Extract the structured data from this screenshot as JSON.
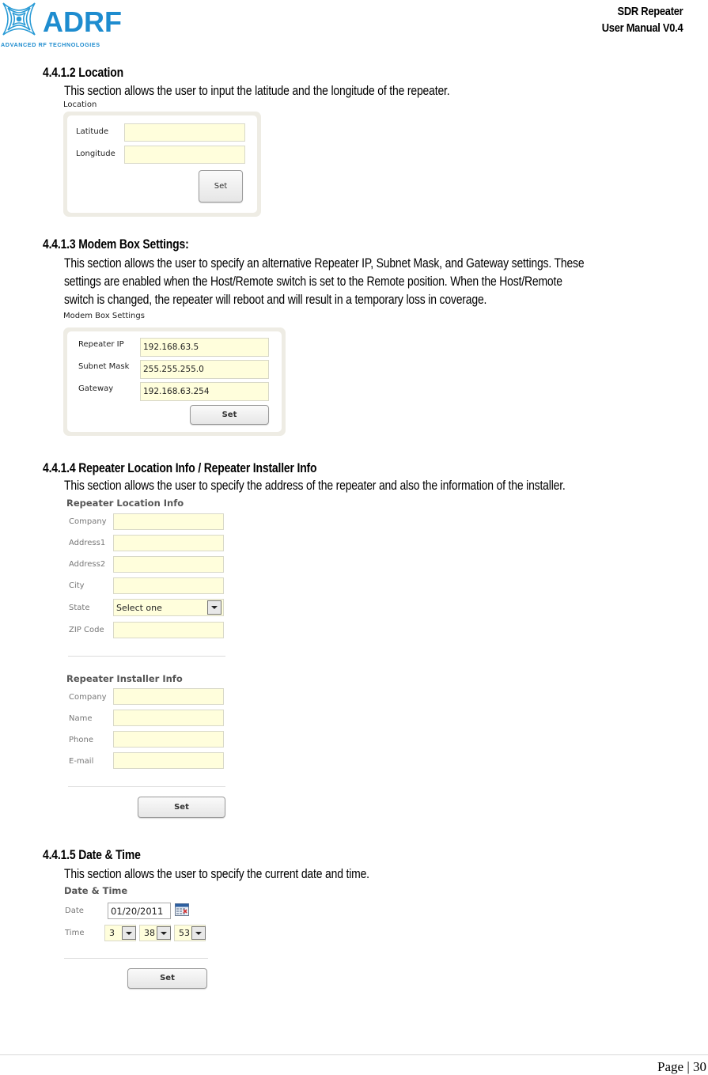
{
  "header": {
    "logo_text": "ADRF",
    "logo_tagline": "ADVANCED RF TECHNOLOGIES",
    "doc_title": "SDR Repeater",
    "doc_subtitle": "User Manual V0.4",
    "brand_color": "#1e8ccf"
  },
  "sections": {
    "location": {
      "heading": "4.4.1.2 Location",
      "body": "This section allows the user to input the latitude and the longitude of the repeater.",
      "caption": "Location",
      "fields": [
        {
          "label": "Latitude",
          "value": ""
        },
        {
          "label": "Longitude",
          "value": ""
        }
      ],
      "button": "Set"
    },
    "modem": {
      "heading": "4.4.1.3 Modem Box Settings:",
      "body_lines": [
        "This section allows the user to specify an alternative Repeater IP, Subnet Mask, and Gateway settings.   These",
        "settings are enabled when the Host/Remote switch is set to the Remote position.   When the Host/Remote",
        "switch is changed, the repeater will reboot and will result in a temporary loss in coverage."
      ],
      "caption": "Modem Box Settings",
      "fields": [
        {
          "label": "Repeater IP",
          "value": "192.168.63.5"
        },
        {
          "label": "Subnet Mask",
          "value": "255.255.255.0"
        },
        {
          "label": "Gateway",
          "value": "192.168.63.254"
        }
      ],
      "button": "Set"
    },
    "info": {
      "heading": "4.4.1.4 Repeater Location Info / Repeater Installer Info",
      "body": "This section allows the user to specify the address of the repeater and also the information of the installer.",
      "location_title": "Repeater Location Info",
      "location_fields": [
        {
          "label": "Company",
          "value": ""
        },
        {
          "label": "Address1",
          "value": ""
        },
        {
          "label": "Address2",
          "value": ""
        },
        {
          "label": "City",
          "value": ""
        },
        {
          "label": "State",
          "value": "Select one"
        },
        {
          "label": "ZIP Code",
          "value": ""
        }
      ],
      "installer_title": "Repeater Installer Info",
      "installer_fields": [
        {
          "label": "Company",
          "value": ""
        },
        {
          "label": "Name",
          "value": ""
        },
        {
          "label": "Phone",
          "value": ""
        },
        {
          "label": "E-mail",
          "value": ""
        }
      ],
      "button": "Set"
    },
    "datetime": {
      "heading": "4.4.1.5 Date & Time",
      "body": "This section allows the user to specify the current date and time.",
      "title": "Date & Time",
      "date_label": "Date",
      "date_value": "01/20/2011",
      "time_label": "Time",
      "hour": "3",
      "minute": "38",
      "second": "53",
      "button": "Set"
    }
  },
  "footer": {
    "page_label": "Page | 30"
  }
}
